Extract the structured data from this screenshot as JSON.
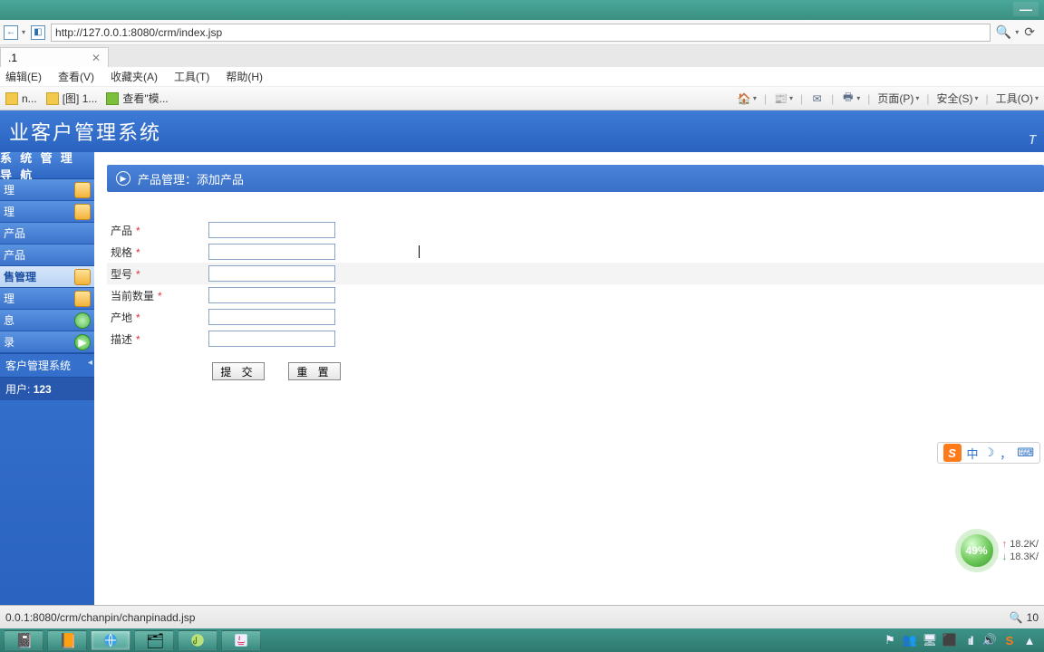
{
  "window": {
    "minimize_title": "Minimize"
  },
  "browser": {
    "url": "http://127.0.0.1:8080/crm/index.jsp",
    "search_tooltip": "Search",
    "refresh_tooltip": "Refresh",
    "tab_label": ".1"
  },
  "menubar": {
    "edit": "编辑(E)",
    "view": "查看(V)",
    "favorites": "收藏夹(A)",
    "tools": "工具(T)",
    "help": "帮助(H)"
  },
  "favbar": {
    "item1_prefix": "n...",
    "item2": "[图] 1...",
    "item3": "查看\"模...",
    "right": {
      "page": "页面(P)",
      "safety": "安全(S)",
      "tools": "工具(O)"
    }
  },
  "app": {
    "title": "业客户管理系统",
    "logo_right": "ᴛ"
  },
  "sidebar": {
    "title": "系 统 管 理 导 航",
    "items": [
      {
        "label": "理",
        "icon": "folder"
      },
      {
        "label": "理",
        "icon": "folder"
      },
      {
        "label": "产品",
        "icon": ""
      },
      {
        "label": "产品",
        "icon": ""
      },
      {
        "label": "售管理",
        "icon": "folder"
      },
      {
        "label": "理",
        "icon": "folder"
      },
      {
        "label": "息",
        "icon": "globe"
      },
      {
        "label": "录",
        "icon": "play"
      }
    ],
    "footer1": "客户管理系统",
    "footer2_label": "用户:",
    "footer2_value": "123"
  },
  "panel": {
    "heading": "产品管理：添加产品"
  },
  "form": {
    "fields": [
      {
        "label": "产品",
        "required": true
      },
      {
        "label": "规格",
        "required": true
      },
      {
        "label": "型号",
        "required": true
      },
      {
        "label": "当前数量",
        "required": true
      },
      {
        "label": "产地",
        "required": true
      },
      {
        "label": "描述",
        "required": true
      }
    ],
    "submit": "提 交",
    "reset": "重 置"
  },
  "ime": {
    "lang": "中",
    "punct": "，"
  },
  "net": {
    "gauge": "49%",
    "up": "18.2K/",
    "down": "18.3K/"
  },
  "statusbar": {
    "left": "0.0.1:8080/crm/chanpin/chanpinadd.jsp",
    "zoom": "10"
  },
  "tray": {
    "signal": "ııll"
  }
}
